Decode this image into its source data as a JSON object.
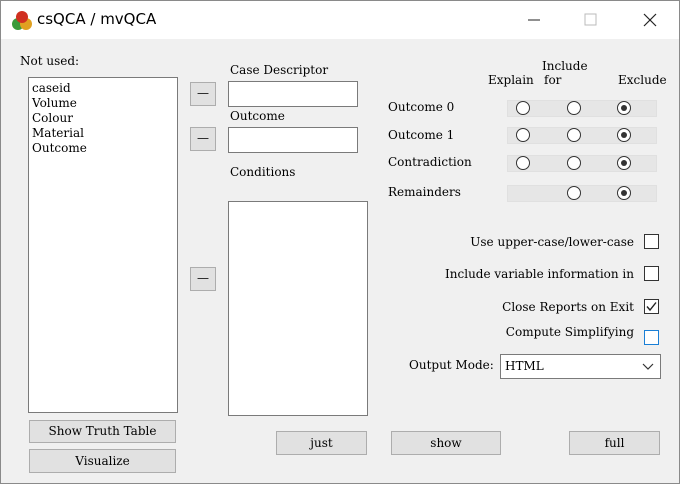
{
  "window": {
    "title": "csQCA / mvQCA",
    "minimize": "—",
    "maximize": "☐",
    "close": "✕"
  },
  "left": {
    "not_used_label": "Not used:",
    "items": [
      "caseid",
      "Volume",
      "Colour",
      "Material",
      "Outcome"
    ],
    "show_truth_table": "Show Truth Table",
    "visualize": "Visualize"
  },
  "middle": {
    "move_button": "—",
    "case_descriptor_label": "Case Descriptor",
    "case_descriptor_value": "",
    "outcome_label": "Outcome",
    "outcome_value": "",
    "conditions_label": "Conditions"
  },
  "options": {
    "col_explain": "Explain",
    "col_include": "Include for",
    "col_include_l1": "Include",
    "col_include_l2": "for",
    "col_exclude": "Exclude",
    "rows": [
      {
        "label": "Outcome 0",
        "selected": "exclude"
      },
      {
        "label": "Outcome 1",
        "selected": "exclude"
      },
      {
        "label": "Contradiction",
        "selected": "exclude"
      },
      {
        "label": "Remainders",
        "selected": "exclude"
      }
    ],
    "use_case": {
      "label": "Use upper-case/lower-case",
      "checked": false
    },
    "include_var_info": {
      "label": "Include variable information in",
      "checked": false
    },
    "close_reports": {
      "label": "Close Reports on Exit",
      "checked": true
    },
    "compute_simplifying": {
      "label": "Compute Simplifying",
      "checked": false
    },
    "output_mode_label": "Output Mode:",
    "output_mode_value": "HTML"
  },
  "buttons": {
    "just": "just",
    "show": "show",
    "full": "full"
  },
  "colors": {
    "checkbox_focus": "#1a7fd6",
    "titlebar_bg": "#ffffff",
    "window_bg": "#f0f0f0"
  }
}
